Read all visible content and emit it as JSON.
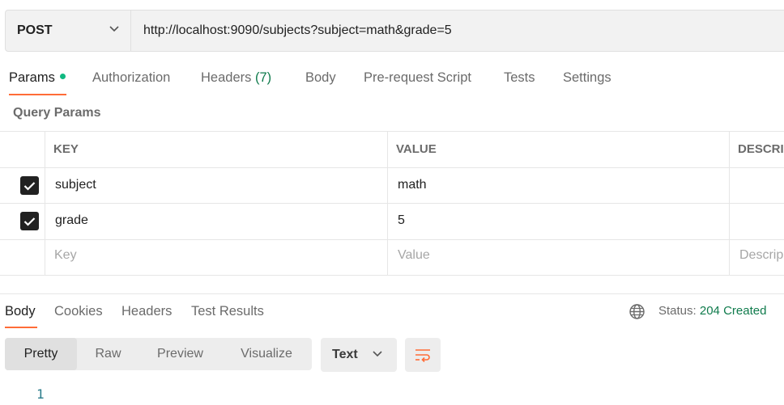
{
  "request": {
    "method": "POST",
    "url": "http://localhost:9090/subjects?subject=math&grade=5"
  },
  "tabs": {
    "params": "Params",
    "authorization": "Authorization",
    "headers": "Headers",
    "headers_count": "(7)",
    "body": "Body",
    "prerequest": "Pre-request Script",
    "tests": "Tests",
    "settings": "Settings"
  },
  "query_params": {
    "title": "Query Params",
    "columns": {
      "key": "KEY",
      "value": "VALUE",
      "description": "DESCRI"
    },
    "rows": [
      {
        "checked": true,
        "key": "subject",
        "value": "math"
      },
      {
        "checked": true,
        "key": "grade",
        "value": "5"
      }
    ],
    "placeholders": {
      "key": "Key",
      "value": "Value",
      "description": "Descrip"
    }
  },
  "response": {
    "tabs": {
      "body": "Body",
      "cookies": "Cookies",
      "headers": "Headers",
      "test_results": "Test Results"
    },
    "status_label": "Status:",
    "status_code": "204 Created",
    "views": {
      "pretty": "Pretty",
      "raw": "Raw",
      "preview": "Preview",
      "visualize": "Visualize"
    },
    "format": "Text",
    "line_number": "1"
  },
  "colors": {
    "accent": "#ff6c37",
    "status_ok": "#0f7b4c",
    "dot": "#10b981"
  }
}
